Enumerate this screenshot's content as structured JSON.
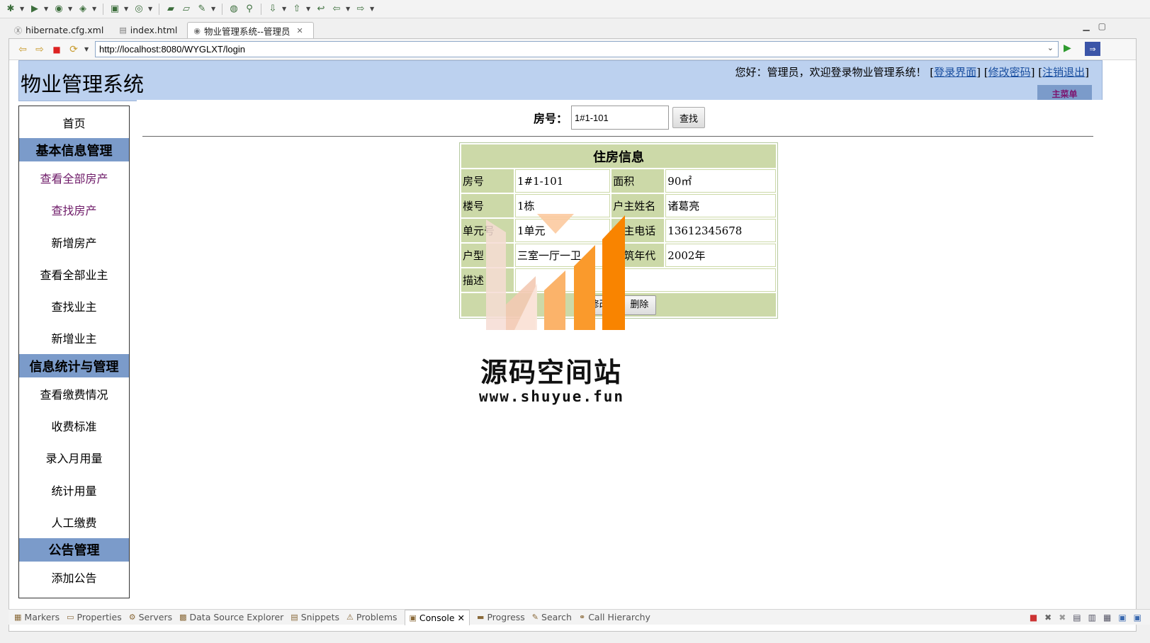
{
  "ide": {
    "editor_tabs": [
      {
        "label": "hibernate.cfg.xml"
      },
      {
        "label": "index.html"
      },
      {
        "label": "物业管理系统--管理员"
      }
    ],
    "bottom_tabs": [
      {
        "label": "Markers"
      },
      {
        "label": "Properties"
      },
      {
        "label": "Servers"
      },
      {
        "label": "Data Source Explorer"
      },
      {
        "label": "Snippets"
      },
      {
        "label": "Problems"
      },
      {
        "label": "Console"
      },
      {
        "label": "Progress"
      },
      {
        "label": "Search"
      },
      {
        "label": "Call Hierarchy"
      }
    ]
  },
  "browser": {
    "url": "http://localhost:8080/WYGLXT/login"
  },
  "header": {
    "title": "物业管理系统",
    "welcome": "您好：管理员，欢迎登录物业管理系统！",
    "link_login": "登录界面",
    "link_password": "修改密码",
    "link_logout": "注销退出",
    "menu_badge": "主菜单"
  },
  "sidebar": {
    "home": "首页",
    "section_basic": "基本信息管理",
    "basic_items": [
      "查看全部房产",
      "查找房产",
      "新增房产",
      "查看全部业主",
      "查找业主",
      "新增业主"
    ],
    "section_stats": "信息统计与管理",
    "stats_items": [
      "查看缴费情况",
      "收费标准",
      "录入月用量",
      "统计用量",
      "人工缴费"
    ],
    "section_notice": "公告管理",
    "notice_items": [
      "添加公告"
    ]
  },
  "search": {
    "label": "房号：",
    "value": "1#1-101",
    "button": "查找"
  },
  "house": {
    "title": "住房信息",
    "room_label": "房号",
    "room_value": "1#1-101",
    "area_label": "面积",
    "area_value": "90㎡",
    "building_label": "楼号",
    "building_value": "1栋",
    "owner_label": "户主姓名",
    "owner_value": "诸葛亮",
    "unit_label": "单元号",
    "unit_value": "1单元",
    "phone_label": "户主电话",
    "phone_value": "13612345678",
    "type_label": "户型",
    "type_value": "三室一厅一卫",
    "year_label": "建筑年代",
    "year_value": "2002年",
    "desc_label": "描述",
    "desc_value": "",
    "edit_button": "修改",
    "delete_button": "删除"
  },
  "watermark": {
    "name": "源码空间站",
    "url": "www.shuyue.fun"
  }
}
